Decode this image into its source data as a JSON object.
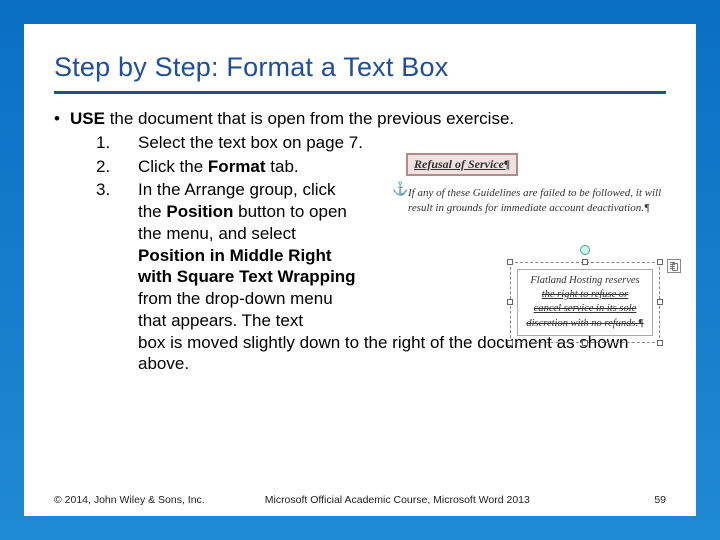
{
  "title": "Step by Step: Format a Text Box",
  "lead_prefix": "USE",
  "lead_rest": " the document that is open from the previous exercise.",
  "steps": {
    "s1": "Select the text box on page 7.",
    "s2_a": "Click the ",
    "s2_b": "Format",
    "s2_c": " tab.",
    "s3_a": "In the Arrange group, click the ",
    "s3_b": "Position",
    "s3_c": " button to open the menu, and select ",
    "s3_d": "Position in Middle Right with Square Text Wrapping",
    "s3_e": " from the drop-down menu that appears. The text",
    "s3_f": "box is moved slightly down to the right of the document as shown above."
  },
  "figure": {
    "heading": "Refusal of Service¶",
    "para": "If any of these Guidelines are failed to be followed, it will result in grounds for immediate account deactivation.¶",
    "textbox_l1": "Flatland Hosting reserves",
    "textbox_l2": "the right to refuse or",
    "textbox_l3": "cancel service in its sole",
    "textbox_l4": "discretion with no refunds.¶"
  },
  "footer": {
    "copyright": "© 2014, John Wiley & Sons, Inc.",
    "course": "Microsoft Official Academic Course, Microsoft Word 2013",
    "page": "59"
  }
}
